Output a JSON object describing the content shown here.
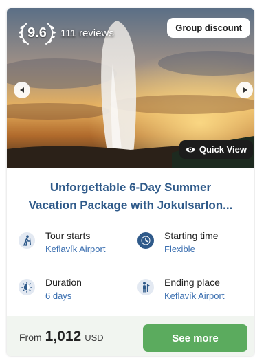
{
  "hero": {
    "rating_score": "9.6",
    "reviews_text": "111 reviews",
    "badge_text": "Group discount",
    "quick_view_label": "Quick View",
    "prev_icon": "chevron-left-icon",
    "next_icon": "chevron-right-icon"
  },
  "tour": {
    "title_line1": "Unforgettable 6-Day Summer",
    "title_line2": "Vacation Package with Jokulsarlon..."
  },
  "facts": [
    {
      "icon": "hiker-icon",
      "label": "Tour starts",
      "value": "Keflavík Airport"
    },
    {
      "icon": "clock-icon",
      "label": "Starting time",
      "value": "Flexible"
    },
    {
      "icon": "sun-moon-icon",
      "label": "Duration",
      "value": "6 days"
    },
    {
      "icon": "person-flag-icon",
      "label": "Ending place",
      "value": "Keflavík Airport"
    }
  ],
  "footer": {
    "price_prefix": "From",
    "price_amount": "1,012",
    "price_currency": "USD",
    "cta_label": "See more"
  },
  "colors": {
    "title": "#2f5a8a",
    "link": "#3b6fb0",
    "cta": "#5bab5e",
    "footer_bg": "#f1f5f0"
  }
}
